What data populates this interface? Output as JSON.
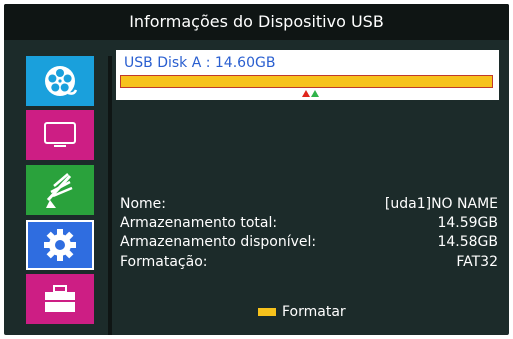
{
  "title": "Informações do Dispositivo USB",
  "sidebar": {
    "items": [
      {
        "id": "media",
        "icon": "film-reel-icon",
        "color": "#1aa0dc"
      },
      {
        "id": "tv",
        "icon": "tv-icon",
        "color": "#cd1e84"
      },
      {
        "id": "antenna",
        "icon": "satellite-dish-icon",
        "color": "#2aa23c"
      },
      {
        "id": "settings",
        "icon": "gear-icon",
        "color": "#2f6de0",
        "selected": true
      },
      {
        "id": "toolbox",
        "icon": "toolbox-icon",
        "color": "#cd1e84"
      }
    ]
  },
  "device": {
    "label": "USB Disk A : 14.60GB",
    "bar_color": "#f7c21c"
  },
  "info": {
    "name": {
      "label": "Nome:",
      "value": "[uda1]NO NAME"
    },
    "total": {
      "label": "Armazenamento total:",
      "value": "14.59GB"
    },
    "free": {
      "label": "Armazenamento disponível:",
      "value": "14.58GB"
    },
    "format": {
      "label": "Formatação:",
      "value": "FAT32"
    }
  },
  "hint": {
    "key_color": "yellow",
    "label": "Formatar"
  }
}
